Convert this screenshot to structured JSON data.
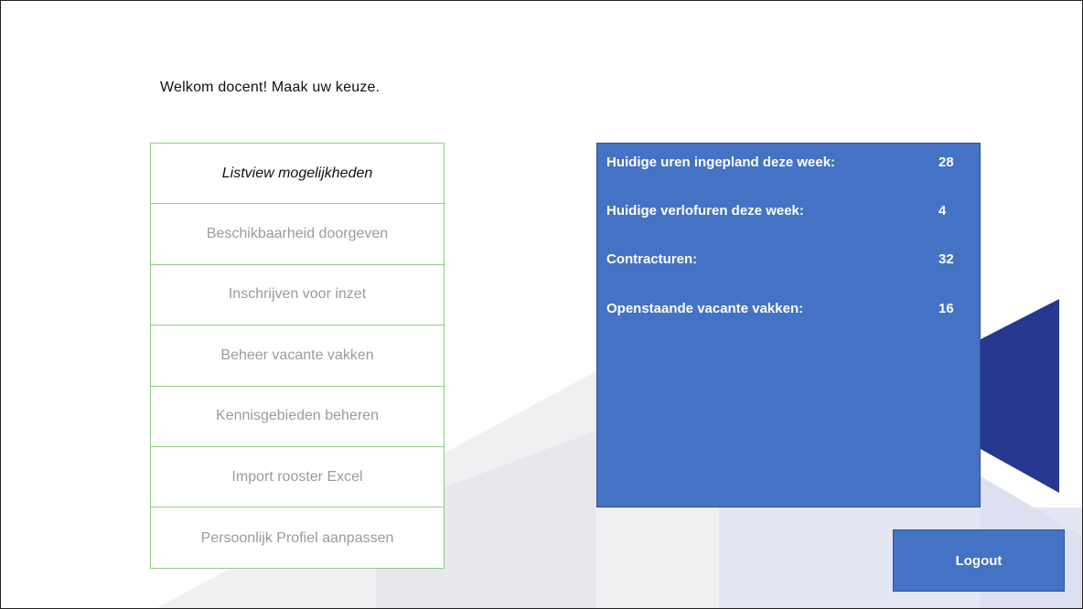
{
  "welcome_text": "Welkom docent! Maak uw keuze.",
  "menu": {
    "items": [
      {
        "label": "Listview mogelijkheden",
        "active": true
      },
      {
        "label": "Beschikbaarheid doorgeven",
        "active": false
      },
      {
        "label": "Inschrijven voor inzet",
        "active": false
      },
      {
        "label": "Beheer vacante vakken",
        "active": false
      },
      {
        "label": "Kennisgebieden beheren",
        "active": false
      },
      {
        "label": "Import rooster Excel",
        "active": false
      },
      {
        "label": "Persoonlijk Profiel aanpassen",
        "active": false
      }
    ]
  },
  "stats": {
    "rows": [
      {
        "label": "Huidige uren ingepland deze week:",
        "value": "28"
      },
      {
        "label": "Huidige verlofuren deze week:",
        "value": "4"
      },
      {
        "label": "Contracturen:",
        "value": "32"
      },
      {
        "label": "Openstaande vacante vakken:",
        "value": "16"
      }
    ]
  },
  "logout_label": "Logout",
  "colors": {
    "accent": "#4472c4",
    "menu_border": "#8fcf7e",
    "dark_shape": "#25378f"
  }
}
